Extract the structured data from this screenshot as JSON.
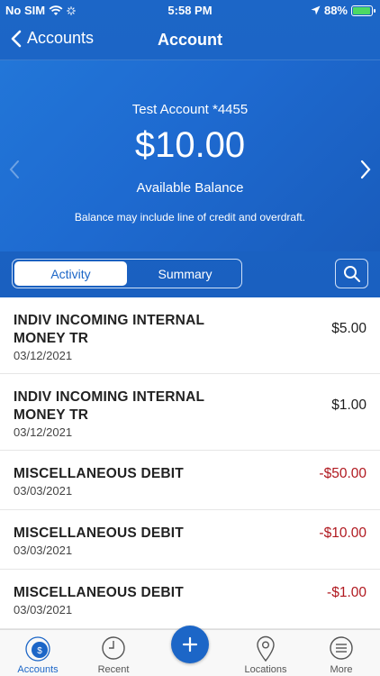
{
  "status_bar": {
    "carrier": "No SIM",
    "time": "5:58 PM",
    "battery": "88%",
    "icons": [
      "wifi-icon",
      "activity-spinner-icon",
      "location-arrow-icon",
      "battery-charging-icon"
    ]
  },
  "nav": {
    "back_label": "Accounts",
    "title": "Account"
  },
  "account": {
    "name": "Test Account *4455",
    "balance": "$10.00",
    "balance_label": "Available Balance",
    "note": "Balance may include line of credit and overdraft."
  },
  "segments": {
    "activity": "Activity",
    "summary": "Summary",
    "selected": "Activity"
  },
  "transactions": [
    {
      "description": "INDIV INCOMING INTERNAL MONEY TR",
      "date": "03/12/2021",
      "amount": "$5.00"
    },
    {
      "description": "INDIV INCOMING INTERNAL MONEY TR",
      "date": "03/12/2021",
      "amount": "$1.00"
    },
    {
      "description": "MISCELLANEOUS DEBIT",
      "date": "03/03/2021",
      "amount": "-$50.00"
    },
    {
      "description": "MISCELLANEOUS DEBIT",
      "date": "03/03/2021",
      "amount": "-$10.00"
    },
    {
      "description": "MISCELLANEOUS DEBIT",
      "date": "03/03/2021",
      "amount": "-$1.00"
    }
  ],
  "tabbar": {
    "accounts": "Accounts",
    "recent": "Recent",
    "locations": "Locations",
    "more": "More"
  },
  "colors": {
    "brand_blue": "#1c66c7",
    "debit_red": "#b0181f",
    "battery_green": "#4cd964"
  }
}
